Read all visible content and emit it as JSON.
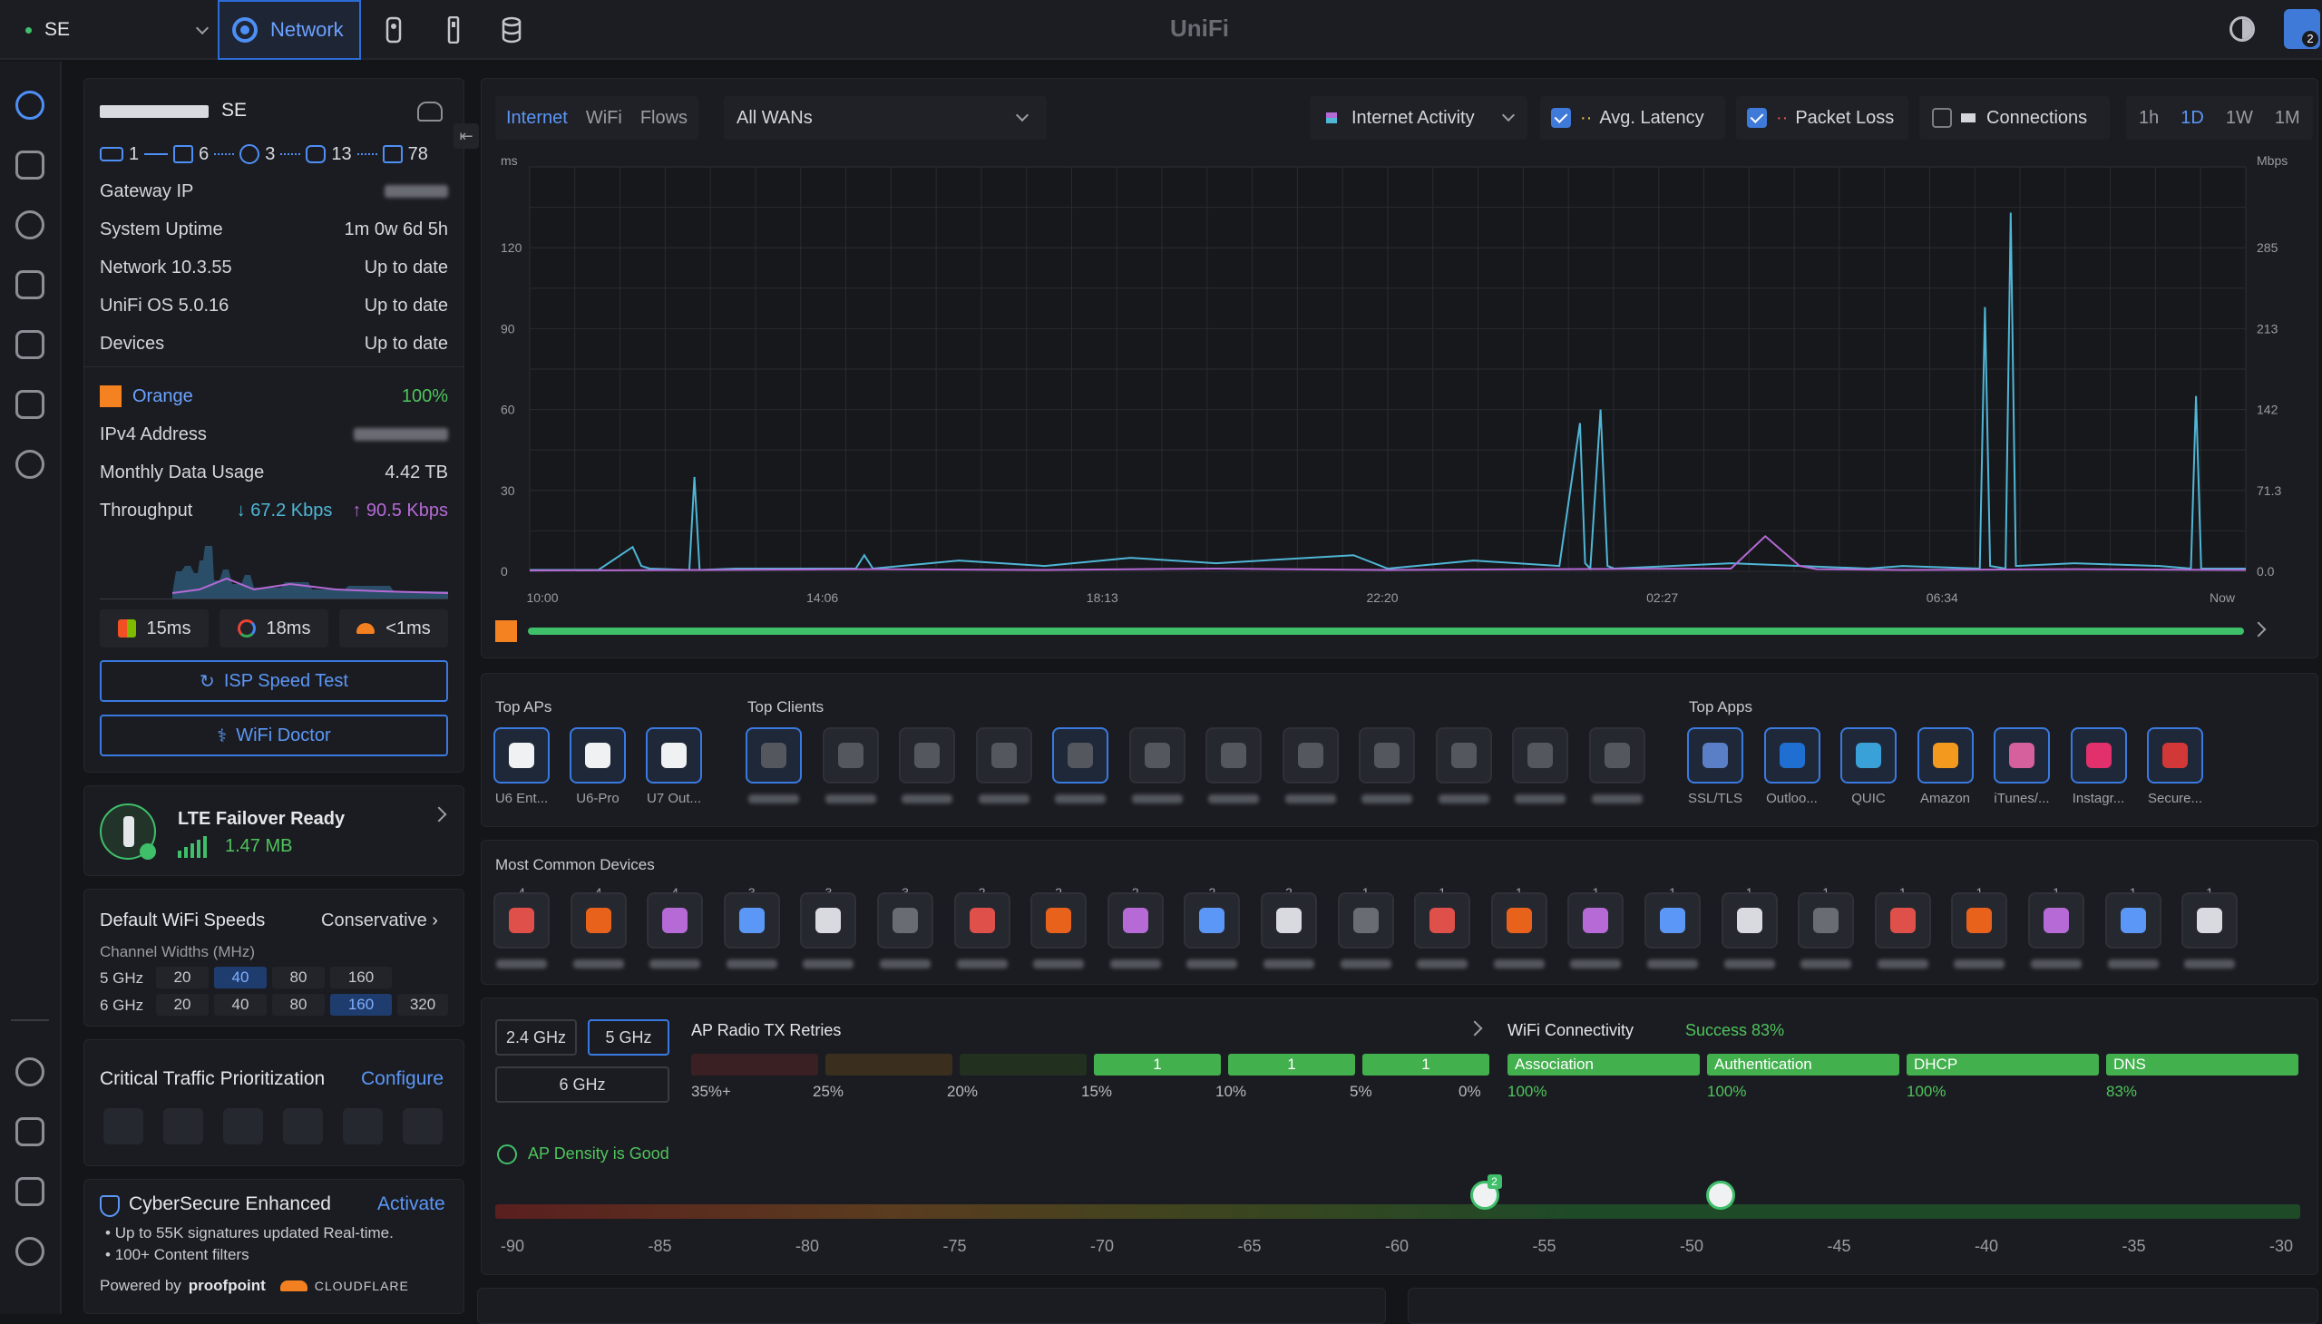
{
  "topbar": {
    "site": "SE",
    "network_tab": "Network",
    "logo": "UniFi",
    "badge": "2"
  },
  "device": {
    "name": "SE",
    "stats": [
      "1",
      "6",
      "3",
      "13",
      "78"
    ],
    "rows": [
      {
        "label": "Gateway IP",
        "value": ""
      },
      {
        "label": "System Uptime",
        "value": "1m 0w 6d 5h"
      },
      {
        "label": "Network 10.3.55",
        "value": "Up to date"
      },
      {
        "label": "UniFi OS 5.0.16",
        "value": "Up to date"
      },
      {
        "label": "Devices",
        "value": "Up to date"
      }
    ],
    "isp": "Orange",
    "isp_pct": "100%",
    "ipv4_label": "IPv4 Address",
    "monthly_label": "Monthly Data Usage",
    "monthly_value": "4.42 TB",
    "throughput_label": "Throughput",
    "down": "67.2 Kbps",
    "up": "90.5 Kbps",
    "latencies": [
      "15ms",
      "18ms",
      "<1ms"
    ],
    "speed_test": "ISP Speed Test",
    "wifi_doctor": "WiFi Doctor"
  },
  "lte": {
    "title": "LTE Failover Ready",
    "usage": "1.47 MB"
  },
  "wifi_speeds": {
    "title": "Default WiFi Speeds",
    "mode": "Conservative",
    "sub": "Channel Widths (MHz)",
    "rows": [
      {
        "band": "5 GHz",
        "w": [
          "20",
          "40",
          "80",
          "160"
        ],
        "sel": 1
      },
      {
        "band": "6 GHz",
        "w": [
          "20",
          "40",
          "80",
          "160",
          "320"
        ],
        "sel": 3
      }
    ]
  },
  "ctp": {
    "title": "Critical Traffic Prioritization",
    "action": "Configure"
  },
  "cyber": {
    "title": "CyberSecure Enhanced",
    "action": "Activate",
    "bullets": [
      "Up to 55K signatures updated Real-time.",
      "100+ Content filters"
    ],
    "powered": "Powered by",
    "brand1": "proofpoint",
    "brand2": "CLOUDFLARE"
  },
  "chart_controls": {
    "tabs": [
      "Internet",
      "WiFi",
      "Flows"
    ],
    "wan": "All WANs",
    "activity": "Internet Activity",
    "avg_latency": "Avg. Latency",
    "packet_loss": "Packet Loss",
    "connections": "Connections",
    "ranges": [
      "1h",
      "1D",
      "1W",
      "1M"
    ]
  },
  "chart_data": {
    "type": "line",
    "ylabel_left": "ms",
    "ylabel_right": "Mbps",
    "y_left_ticks": [
      "120",
      "90",
      "60",
      "30",
      "0"
    ],
    "y_right_ticks": [
      "285",
      "213",
      "142",
      "71.3",
      "0.0"
    ],
    "x_ticks": [
      "10:00",
      "14:06",
      "18:13",
      "22:20",
      "02:27",
      "06:34",
      "Now"
    ],
    "ylim": [
      0,
      150
    ],
    "series": [
      {
        "color": "#4fb6d6",
        "x": [
          0,
          4,
          6,
          6.5,
          7,
          9.3,
          9.6,
          9.9,
          12,
          19,
          19.5,
          20,
          25,
          30,
          35,
          40,
          48,
          50,
          55,
          60,
          61.2,
          61.5,
          61.8,
          62.4,
          62.8,
          63.2,
          70,
          78,
          80,
          84.5,
          84.8,
          85.1,
          86,
          86.3,
          86.6,
          90,
          95,
          96.8,
          97.1,
          97.4,
          100
        ],
        "y": [
          0.5,
          0.5,
          9,
          2,
          1,
          0.5,
          35,
          0.5,
          1,
          1,
          6,
          1,
          4,
          2,
          5,
          3,
          6,
          1,
          4,
          2,
          55,
          3,
          1,
          60,
          2,
          1,
          3,
          1,
          2,
          1,
          98,
          2,
          1,
          133,
          2,
          3,
          2,
          1,
          65,
          1,
          1
        ]
      },
      {
        "color": "#b56ad6",
        "x": [
          0,
          10,
          20,
          30,
          40,
          50,
          60,
          70,
          72,
          74,
          75,
          80,
          90,
          100
        ],
        "y": [
          0.3,
          0.5,
          0.8,
          0.5,
          1,
          0.5,
          0.8,
          1,
          13,
          2,
          0.8,
          0.5,
          0.8,
          0.5
        ]
      }
    ]
  },
  "tops": {
    "aps_title": "Top APs",
    "aps": [
      "U6 Ent...",
      "U6-Pro",
      "U7 Out..."
    ],
    "clients_title": "Top Clients",
    "apps_title": "Top Apps",
    "apps": [
      "SSL/TLS",
      "Outloo...",
      "QUIC",
      "Amazon",
      "iTunes/...",
      "Instagr...",
      "Secure..."
    ]
  },
  "common": {
    "title": "Most Common Devices",
    "counts": [
      "4",
      "4",
      "4",
      "3",
      "3",
      "3",
      "2",
      "2",
      "2",
      "2",
      "2",
      "1",
      "1",
      "1",
      "1",
      "1",
      "1",
      "1",
      "1",
      "1",
      "1",
      "1",
      "1"
    ]
  },
  "radio": {
    "bands": [
      "2.4 GHz",
      "5 GHz",
      "6 GHz"
    ],
    "title": "AP Radio TX Retries",
    "bins": [
      "35%+",
      "25%",
      "20%",
      "15%",
      "10%",
      "5%",
      "0%"
    ],
    "values": [
      "",
      "",
      "",
      "1",
      "1",
      "1"
    ],
    "wifi_title": "WiFi Connectivity",
    "success": "Success",
    "success_pct": "83%",
    "stages": [
      {
        "name": "Association",
        "pct": "100%"
      },
      {
        "name": "Authentication",
        "pct": "100%"
      },
      {
        "name": "DHCP",
        "pct": "100%"
      },
      {
        "name": "DNS",
        "pct": "83%"
      }
    ],
    "density": "AP Density is Good",
    "density_ticks": [
      "-90",
      "-85",
      "-80",
      "-75",
      "-70",
      "-65",
      "-60",
      "-55",
      "-50",
      "-45",
      "-40",
      "-35",
      "-30"
    ],
    "markers": [
      {
        "dbm": -57,
        "count": "2"
      },
      {
        "dbm": -49,
        "count": ""
      }
    ]
  }
}
